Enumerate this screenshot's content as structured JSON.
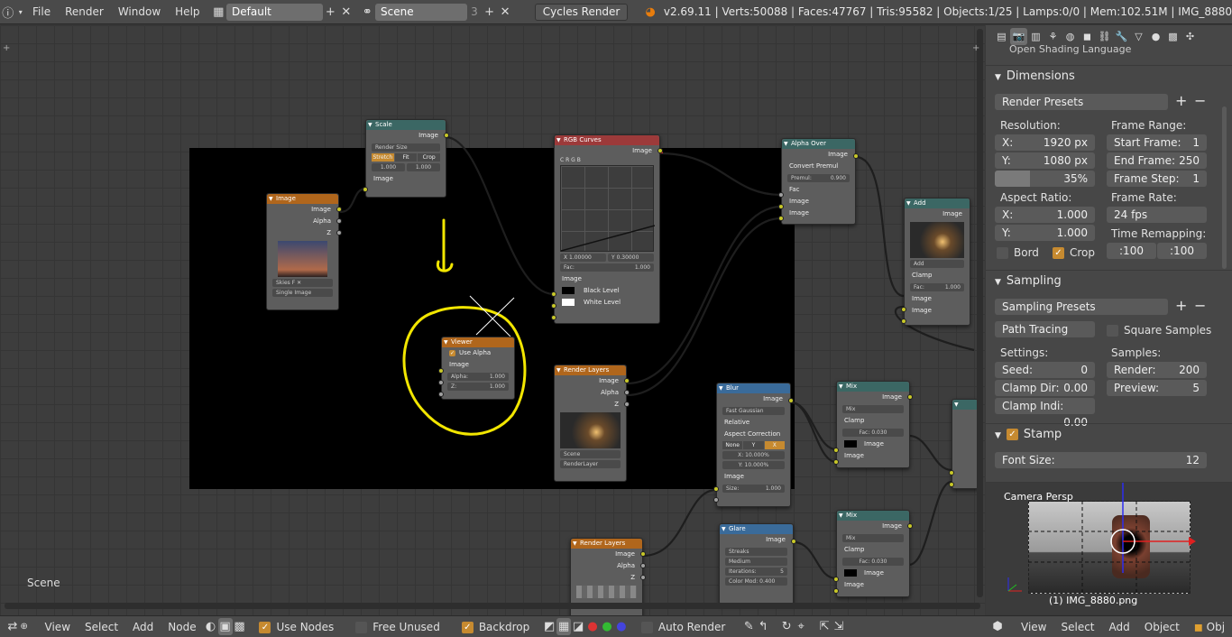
{
  "topbar": {
    "menus": [
      "File",
      "Render",
      "Window",
      "Help"
    ],
    "layout": "Default",
    "scene": "Scene",
    "scene_users": "3",
    "engine": "Cycles Render",
    "stats": "v2.69.11 | Verts:50088 | Faces:47767 | Tris:95582 | Objects:1/25 | Lamps:0/0 | Mem:102.51M | IMG_8880"
  },
  "editor": {
    "scene_label": "Scene"
  },
  "nodes": {
    "image": {
      "title": "Image",
      "out_image": "Image",
      "out_alpha": "Alpha",
      "out_z": "Z",
      "img_name": "Skies",
      "img_users": "F",
      "source": "Single Image"
    },
    "scale": {
      "title": "Scale",
      "out": "Image",
      "space": "Render Size",
      "b1": "Stretch",
      "b2": "Fit",
      "b3": "Crop",
      "v1": "1.000",
      "v2": "1.000",
      "in": "Image"
    },
    "rgb": {
      "title": "RGB Curves",
      "out": "Image",
      "tabs": "C  R  G  B",
      "x": "X 1.00000",
      "y": "Y 0.30000",
      "fac_label": "Fac:",
      "fac": "1.000",
      "in_image": "Image",
      "black": "Black Level",
      "white": "White Level"
    },
    "viewer": {
      "title": "Viewer",
      "use_alpha": "Use Alpha",
      "in_image": "Image",
      "alpha_label": "Alpha:",
      "alpha": "1.000",
      "z_label": "Z:",
      "z": "1.000"
    },
    "renderlayers": {
      "title": "Render Layers",
      "out_image": "Image",
      "out_alpha": "Alpha",
      "out_z": "Z",
      "scene": "Scene",
      "layer": "RenderLayer"
    },
    "alphaover": {
      "title": "Alpha Over",
      "out": "Image",
      "convert": "Convert Premul",
      "premul_label": "Premul:",
      "premul": "0.900",
      "fac": "Fac",
      "in1": "Image",
      "in2": "Image"
    },
    "add": {
      "title": "Add",
      "out": "Image",
      "mode": "Add",
      "clamp": "Clamp",
      "fac_label": "Fac:",
      "fac": "1.000",
      "in1": "Image",
      "in2": "Image"
    },
    "blur": {
      "title": "Blur",
      "out": "Image",
      "type": "Fast Gaussian",
      "relative": "Relative",
      "aspect": "Aspect Correction",
      "a1": "None",
      "a2": "Y",
      "a3": "X",
      "x": "X: 10.000%",
      "y": "Y: 10.000%",
      "in": "Image",
      "size_label": "Size:",
      "size": "1.000"
    },
    "mix1": {
      "title": "Mix",
      "out": "Image",
      "mode": "Mix",
      "clamp": "Clamp",
      "fac_label": "Fac:",
      "fac": "0.030",
      "in1": "Image",
      "in2": "Image"
    },
    "mix2": {
      "title": "Mix",
      "out": "Image",
      "mode": "Mix",
      "clamp": "Clamp",
      "fac_label": "Fac:",
      "fac": "0.030",
      "in1": "Image",
      "in2": "Image"
    },
    "glare": {
      "title": "Glare",
      "out": "Image",
      "type": "Streaks",
      "quality": "Medium",
      "iter_label": "Iterations:",
      "iter": "5",
      "color_mod": "Color Mod: 0.400"
    },
    "renderlayers2": {
      "title": "Render Layers",
      "out_image": "Image",
      "out_alpha": "Alpha",
      "out_z": "Z"
    }
  },
  "properties": {
    "top_partial": "Open Shading Language",
    "dimensions": {
      "title": "Dimensions",
      "presets": "Render Presets",
      "res_label": "Resolution:",
      "res_x_label": "X:",
      "res_x": "1920 px",
      "res_y_label": "Y:",
      "res_y": "1080 px",
      "res_pct": "35%",
      "frame_range_label": "Frame Range:",
      "start_label": "Start Frame:",
      "start": "1",
      "end_label": "End Frame:",
      "end": "250",
      "step_label": "Frame Step:",
      "step": "1",
      "aspect_label": "Aspect Ratio:",
      "asp_x_label": "X:",
      "asp_x": "1.000",
      "asp_y_label": "Y:",
      "asp_y": "1.000",
      "frame_rate_label": "Frame Rate:",
      "frame_rate": "24 fps",
      "time_remap_label": "Time Remapping:",
      "remap_old": ":100",
      "remap_new": ":100",
      "bord": "Bord",
      "crop": "Crop"
    },
    "sampling": {
      "title": "Sampling",
      "presets": "Sampling Presets",
      "method": "Path Tracing",
      "square": "Square Samples",
      "settings_label": "Settings:",
      "seed_label": "Seed:",
      "seed": "0",
      "clamp_dir_label": "Clamp Dir:",
      "clamp_dir": "0.00",
      "clamp_ind_label": "Clamp Indi:",
      "clamp_ind": "0.00",
      "samples_label": "Samples:",
      "render_label": "Render:",
      "render": "200",
      "preview_label": "Preview:",
      "preview": "5"
    },
    "stamp": {
      "title": "Stamp",
      "font_label": "Font Size:",
      "font_size": "12"
    }
  },
  "viewport": {
    "label": "Camera Persp",
    "object": "(1) IMG_8880.png"
  },
  "bottombar": {
    "menus": [
      "View",
      "Select",
      "Add",
      "Node"
    ],
    "use_nodes": "Use Nodes",
    "free_unused": "Free Unused",
    "backdrop": "Backdrop",
    "auto_render": "Auto Render",
    "right_menus": [
      "View",
      "Select",
      "Add",
      "Object"
    ],
    "mode": "Obj"
  },
  "colors": {
    "accent": "#c68a30",
    "annotation": "#f2e600",
    "node_orange": "#b0661c",
    "node_teal": "#3b6764",
    "node_red": "#9c3a3a"
  }
}
